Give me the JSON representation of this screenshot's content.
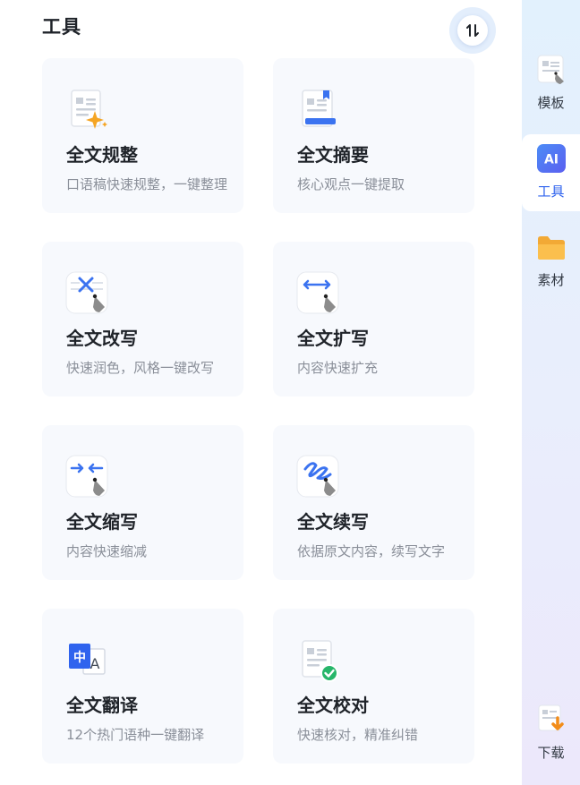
{
  "header": {
    "title": "工具"
  },
  "tools": [
    {
      "name": "全文规整",
      "desc": "口语稿快速规整，一键整理",
      "icon": "doc-sparkle-icon"
    },
    {
      "name": "全文摘要",
      "desc": "核心观点一键提取",
      "icon": "doc-bookmark-icon"
    },
    {
      "name": "全文改写",
      "desc": "快速润色，风格一键改写",
      "icon": "rewrite-pen-icon"
    },
    {
      "name": "全文扩写",
      "desc": "内容快速扩充",
      "icon": "expand-pen-icon"
    },
    {
      "name": "全文缩写",
      "desc": "内容快速缩减",
      "icon": "shrink-pen-icon"
    },
    {
      "name": "全文续写",
      "desc": "依据原文内容，续写文字",
      "icon": "continue-pen-icon"
    },
    {
      "name": "全文翻译",
      "desc": "12个热门语种一键翻译",
      "icon": "translate-icon",
      "glyph_zh": "中",
      "glyph_en": "A"
    },
    {
      "name": "全文校对",
      "desc": "快速核对，精准纠错",
      "icon": "doc-check-icon"
    }
  ],
  "sidebar": {
    "items": [
      {
        "label": "模板",
        "icon": "template-icon",
        "active": false
      },
      {
        "label": "工具",
        "icon": "ai-tools-icon",
        "icon_text": "AI",
        "active": true
      },
      {
        "label": "素材",
        "icon": "folder-icon",
        "active": false
      },
      {
        "label": "下载",
        "icon": "download-icon",
        "active": false
      }
    ]
  },
  "colors": {
    "accent": "#2f63ee",
    "card_bg": "#f7f9fd",
    "title": "#1f2329",
    "desc": "#8a8f99",
    "orange": "#f5a524",
    "green": "#27b66a"
  }
}
